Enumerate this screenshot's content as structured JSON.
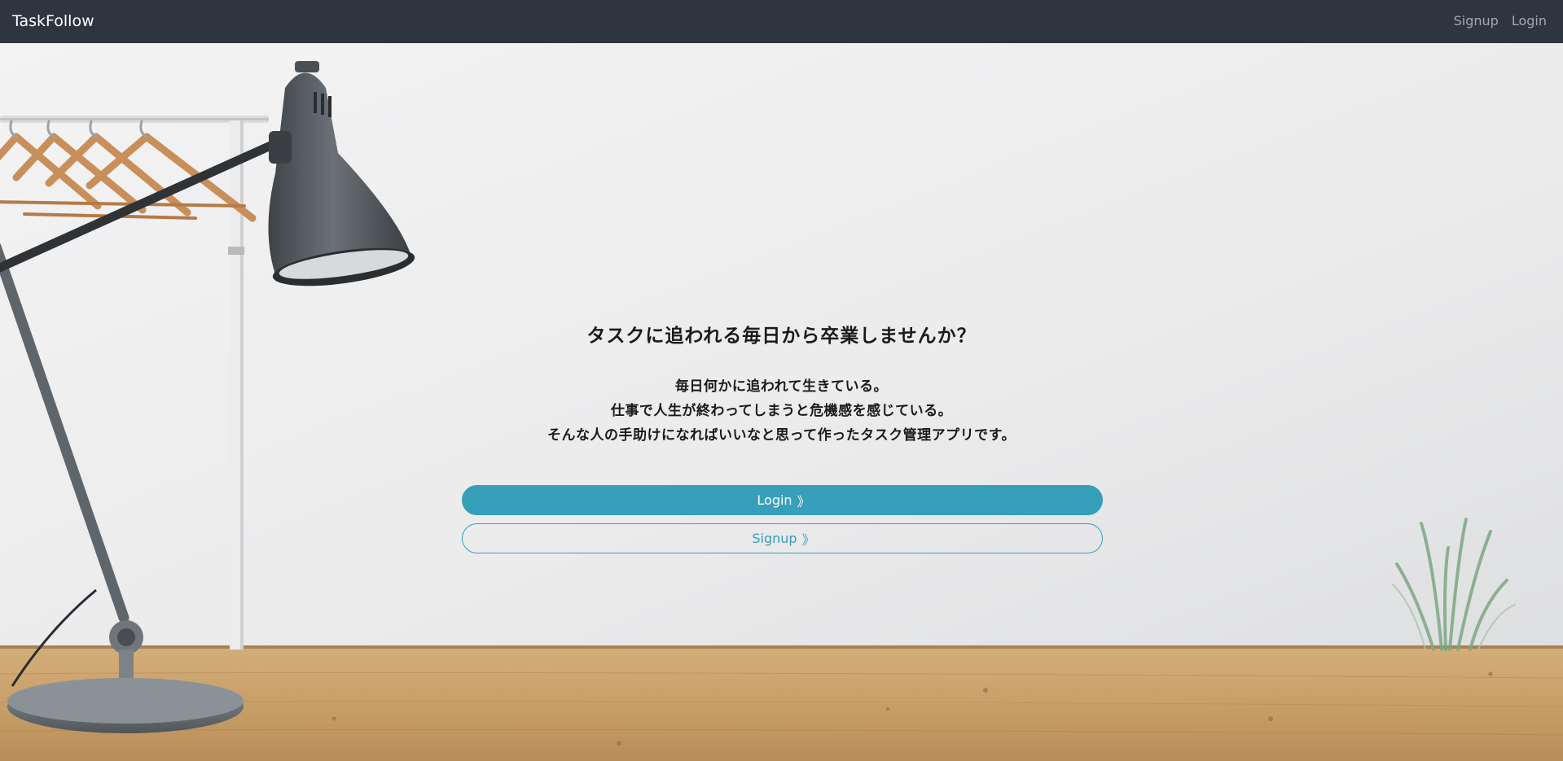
{
  "navbar": {
    "brand": "TaskFollow",
    "links": [
      {
        "label": "Signup"
      },
      {
        "label": "Login"
      }
    ]
  },
  "hero": {
    "headline": "タスクに追われる毎日から卒業しませんか？",
    "description": [
      "毎日何かに追われて生きている。",
      "仕事で人生が終わってしまうと危機感を感じている。",
      "そんな人の手助けになればいいなと思って作ったタスク管理アプリです。"
    ],
    "login_button": "Login",
    "signup_button": "Signup",
    "button_chevron": "》"
  },
  "colors": {
    "navbar_bg": "#2e3440",
    "accent": "#36a0ba",
    "nav_link": "#a4a8ae",
    "wall": "#ececed",
    "desk": "#c9a06a"
  },
  "icons": {
    "chevron": "double-chevron-right-icon"
  }
}
